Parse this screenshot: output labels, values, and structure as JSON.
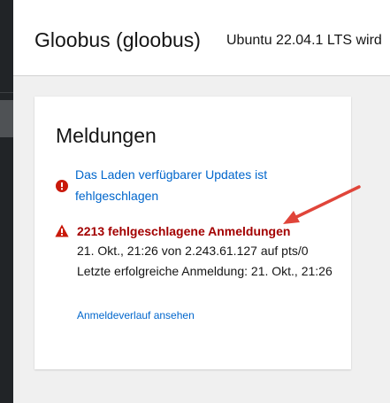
{
  "header": {
    "host_title": "Gloobus (gloobus)",
    "os_version": "Ubuntu 22.04.1 LTS wird"
  },
  "card": {
    "title": "Meldungen",
    "notifications": [
      {
        "icon": "error-circle-icon",
        "text": "Das Laden verfügbarer Updates ist fehlgeschlagen"
      },
      {
        "icon": "warning-triangle-icon",
        "title": "2213 fehlgeschlagene Anmeldungen",
        "detail_1": "21. Okt., 21:26 von 2.243.61.127 auf pts/0",
        "detail_2": "Letzte erfolgreiche Anmeldung: 21. Okt., 21:26",
        "link": "Anmeldeverlauf ansehen"
      }
    ]
  },
  "colors": {
    "nav_background": "#212427",
    "link": "#0066cc",
    "danger": "#c9190b",
    "danger_text": "#a30000",
    "annotation_arrow": "#e0453a"
  }
}
